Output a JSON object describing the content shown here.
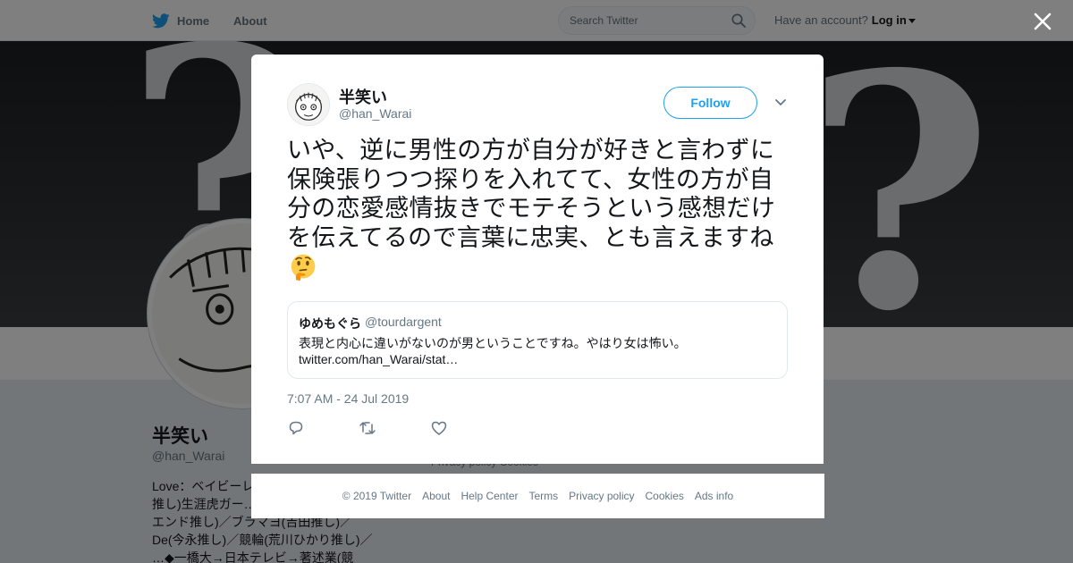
{
  "nav": {
    "home_label": "Home",
    "about_label": "About",
    "search_placeholder": "Search Twitter",
    "account_prompt": "Have an account?",
    "login_label": "Log in",
    "brand_color": "#1da1f2"
  },
  "profile": {
    "name": "半笑い",
    "handle": "@han_Warai",
    "bio": "Love：ベイビーレ…\n推し)生涯虎ガー…\nエンド推し)／ブラマヨ(吉田推し)／\nDe(今永推し)／競輪(荒川ひかり推し)／\n…◆一橋大→日本テレビ→著述業(競",
    "side_links": "Privacy policy   Cookies"
  },
  "tweet": {
    "author_name": "半笑い",
    "author_handle": "@han_Warai",
    "follow_label": "Follow",
    "text": "いや、逆に男性の方が自分が好きと言わずに保険張りつつ探りを入れてて、女性の方が自分の恋愛感情抜きでモテそうという感想だけを伝えてるので言葉に忠実、とも言えますね",
    "emoji": "thinking-face",
    "timestamp": "7:07 AM - 24 Jul 2019",
    "quoted": {
      "name": "ゆめもぐら",
      "handle": "@tourdargent",
      "text": "表現と内心に違いがないのが男ということですね。やはり女は怖い。",
      "link": "twitter.com/han_Warai/stat…"
    }
  },
  "footer": {
    "copyright": "© 2019 Twitter",
    "about": "About",
    "help": "Help Center",
    "terms": "Terms",
    "privacy": "Privacy policy",
    "cookies": "Cookies",
    "ads": "Ads info"
  },
  "colors": {
    "accent": "#1da1f2",
    "muted_text": "#657786",
    "overlay": "rgba(0,0,0,0.5)"
  }
}
